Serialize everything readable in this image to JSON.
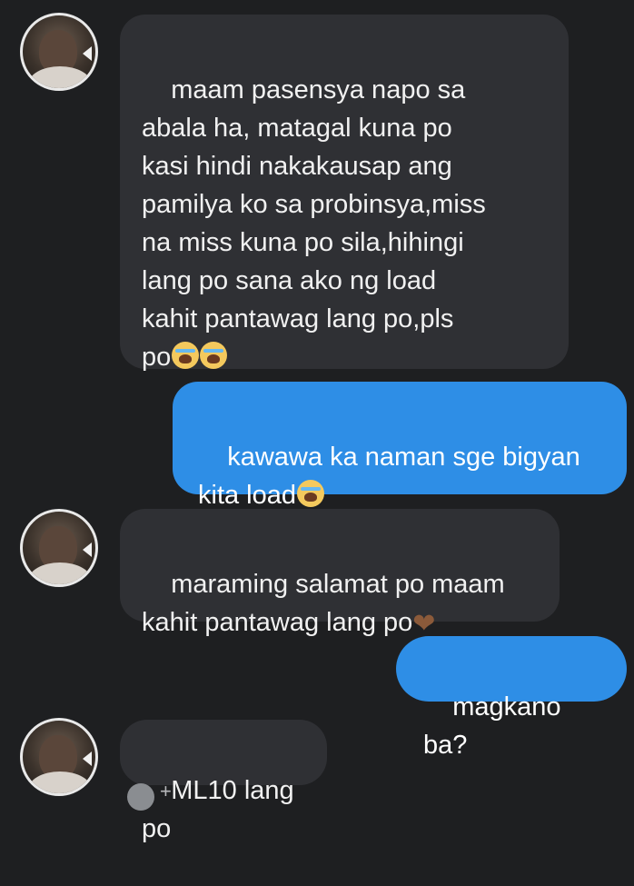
{
  "messages": [
    {
      "direction": "incoming",
      "text": "maam pasensya napo sa\nabala ha, matagal kuna po\nkasi hindi nakakausap ang\npamilya ko sa probinsya,miss\nna miss kuna po sila,hihingi\nlang po sana ako ng load\nkahit pantawag lang po,pls\npo",
      "emoji_icons": [
        "crying-face-icon",
        "crying-face-icon"
      ]
    },
    {
      "direction": "outgoing",
      "text": "kawawa ka naman sge bigyan\nkita load",
      "emoji_icons": [
        "crying-face-icon"
      ]
    },
    {
      "direction": "incoming",
      "text": "maraming salamat po maam\nkahit pantawag lang po",
      "emoji_icons": [
        "brown-heart-icon"
      ]
    },
    {
      "direction": "outgoing",
      "text": "magkano ba?"
    },
    {
      "direction": "incoming",
      "text": "ML10 lang po"
    }
  ],
  "footer": {
    "reaction_plus": "+"
  },
  "colors": {
    "background": "#1e1f21",
    "incoming_bubble": "#2f3034",
    "outgoing_bubble": "#2e8ee6"
  }
}
